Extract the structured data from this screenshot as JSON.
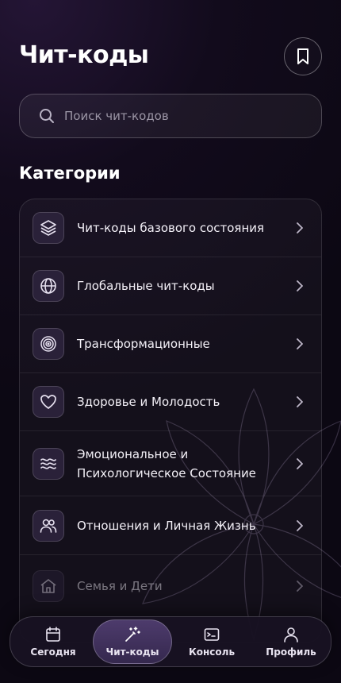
{
  "header": {
    "title": "Чит-коды",
    "bookmark_icon": "bookmark-icon"
  },
  "search": {
    "placeholder": "Поиск чит-кодов",
    "icon": "search-icon"
  },
  "categories": {
    "title": "Категории",
    "items": [
      {
        "label": "Чит-коды базового состояния",
        "icon": "layers-icon"
      },
      {
        "label": "Глобальные чит-коды",
        "icon": "globe-icon"
      },
      {
        "label": "Трансформационные",
        "icon": "spiral-icon"
      },
      {
        "label": "Здоровье и Молодость",
        "icon": "heart-icon"
      },
      {
        "label": "Эмоциональное и Психологическое Состояние",
        "icon": "waves-icon"
      },
      {
        "label": "Отношения и Личная Жизнь",
        "icon": "users-icon"
      },
      {
        "label": "Семья и Дети",
        "icon": "home-icon"
      }
    ]
  },
  "tabbar": {
    "tabs": [
      {
        "label": "Сегодня",
        "icon": "calendar-icon",
        "active": false
      },
      {
        "label": "Чит-коды",
        "icon": "magic-wand-icon",
        "active": true
      },
      {
        "label": "Консоль",
        "icon": "terminal-icon",
        "active": false
      },
      {
        "label": "Профиль",
        "icon": "user-icon",
        "active": false
      }
    ]
  },
  "colors": {
    "background": "#120b1c",
    "accent": "#4d3b6c",
    "text": "#f2eef8",
    "muted": "#9c96a6"
  }
}
